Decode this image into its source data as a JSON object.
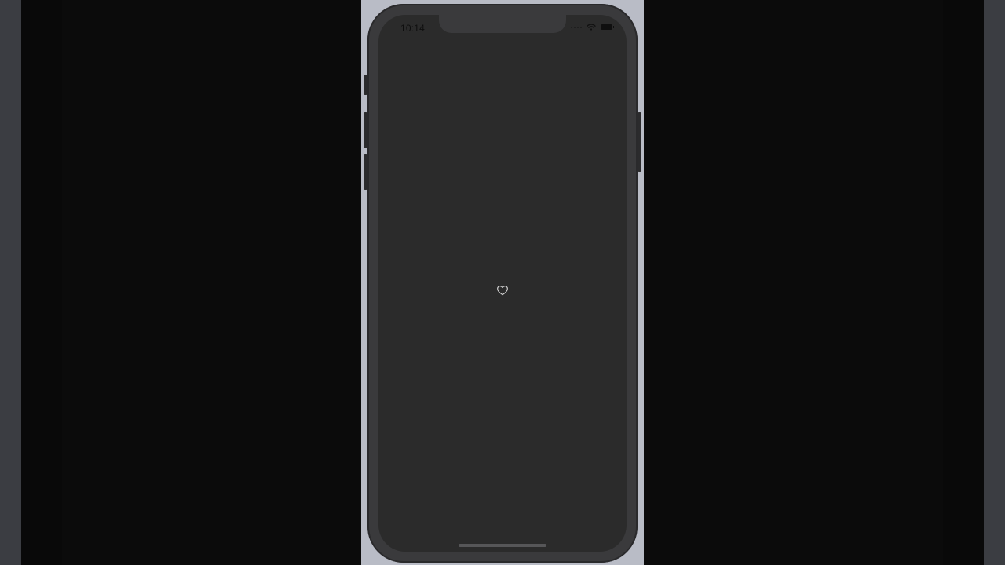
{
  "status_bar": {
    "time": "10:14",
    "wifi_icon": "wifi-icon",
    "signal_icon": "signal-icon",
    "battery_icon": "battery-icon"
  },
  "content": {
    "center_icon": "heart-outline-icon"
  },
  "colors": {
    "background": "#0b0b0b",
    "simulator_window": "#b9bcc6",
    "phone_frame": "#3a3a3c",
    "screen": "#2b2b2b",
    "heart_stroke": "#cfcfcf"
  }
}
